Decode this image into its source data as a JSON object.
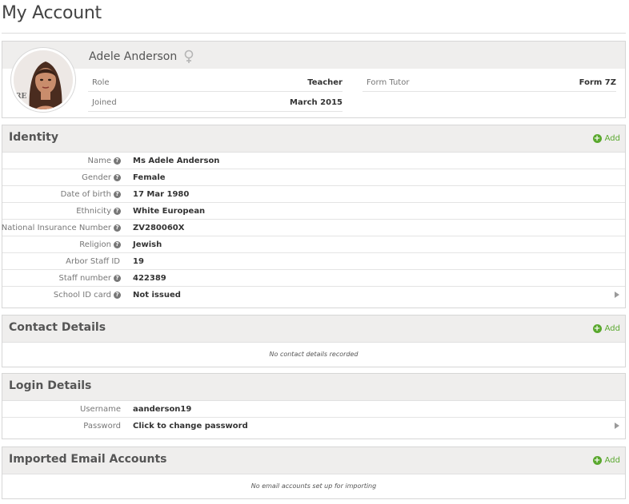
{
  "page": {
    "title": "My Account"
  },
  "profile": {
    "name": "Adele Anderson",
    "fields": [
      {
        "label": "Role",
        "value": "Teacher"
      },
      {
        "label": "Joined",
        "value": "March 2015"
      },
      {
        "label": "Form Tutor",
        "value": "Form 7Z"
      }
    ]
  },
  "identity": {
    "title": "Identity",
    "add_label": "Add",
    "rows": [
      {
        "label": "Name",
        "value": "Ms Adele Anderson",
        "help": true
      },
      {
        "label": "Gender",
        "value": "Female",
        "help": true
      },
      {
        "label": "Date of birth",
        "value": "17 Mar 1980",
        "help": true
      },
      {
        "label": "Ethnicity",
        "value": "White European",
        "help": true
      },
      {
        "label": "National Insurance Number",
        "value": "ZV280060X",
        "help": true
      },
      {
        "label": "Religion",
        "value": "Jewish",
        "help": true
      },
      {
        "label": "Arbor Staff ID",
        "value": "19",
        "help": false
      },
      {
        "label": "Staff number",
        "value": "422389",
        "help": true
      },
      {
        "label": "School ID card",
        "value": "Not issued",
        "help": true
      }
    ]
  },
  "contact": {
    "title": "Contact Details",
    "add_label": "Add",
    "empty_message": "No contact details recorded"
  },
  "login": {
    "title": "Login Details",
    "rows": [
      {
        "label": "Username",
        "value": "aanderson19"
      },
      {
        "label": "Password",
        "value": "Click to change password"
      }
    ]
  },
  "email": {
    "title": "Imported Email Accounts",
    "add_label": "Add",
    "empty_message": "No email accounts set up for importing"
  },
  "colors": {
    "accent": "#5aa82e",
    "header_bg": "#efeeed",
    "border": "#d6d6d6"
  },
  "icons": {
    "gender": "female-symbol-icon",
    "help": "question-circle-icon",
    "add": "plus-circle-icon",
    "expand": "chevron-right-icon"
  }
}
